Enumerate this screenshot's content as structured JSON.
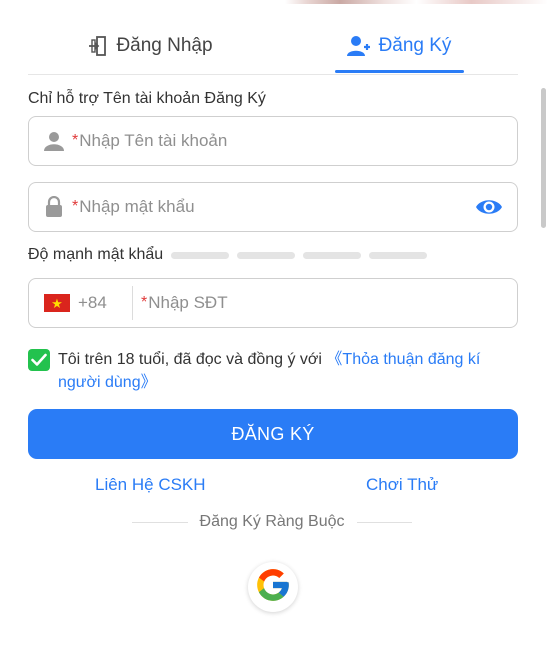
{
  "tabs": {
    "login_label": "Đăng Nhập",
    "register_label": "Đăng Ký",
    "active": "register"
  },
  "form": {
    "hint": "Chỉ hỗ trợ Tên tài khoản Đăng Ký",
    "username_placeholder": "Nhập Tên tài khoản",
    "password_placeholder": "Nhập mật khẩu",
    "required_mark": "*",
    "strength_label": "Độ mạnh mật khẩu",
    "strength_level": 0,
    "phone_country_code": "+84",
    "phone_placeholder": "Nhập SĐT"
  },
  "agreement": {
    "checked": true,
    "text": "Tôi trên 18 tuổi, đã đọc và đồng ý với ",
    "link_text": "《Thỏa thuận đăng kí người dùng》"
  },
  "actions": {
    "register_button": "ĐĂNG KÝ",
    "support_link": "Liên Hệ CSKH",
    "trial_link": "Chơi Thử",
    "bind_divider": "Đăng Ký Ràng Buộc"
  },
  "colors": {
    "accent": "#2a7cf6",
    "required": "#e03a3a",
    "check": "#23c24e"
  },
  "icons": {
    "login_tab": "login-door-icon",
    "register_tab": "add-user-icon",
    "username": "user-icon",
    "password": "lock-icon",
    "show_password": "eye-icon",
    "country": "vietnam-flag-icon",
    "social": "google-icon"
  }
}
